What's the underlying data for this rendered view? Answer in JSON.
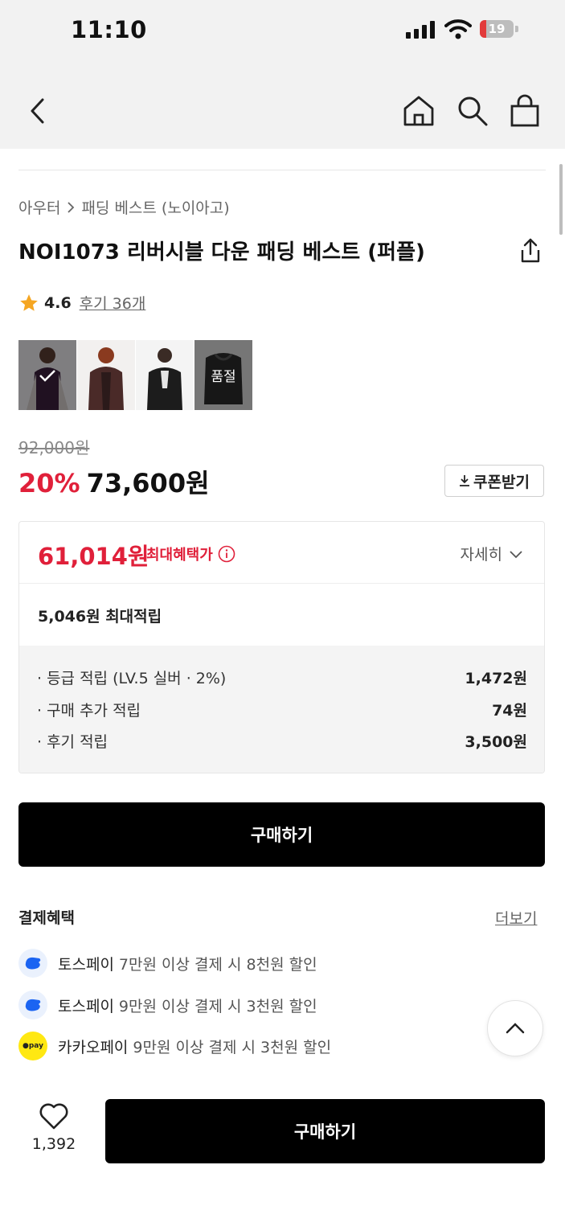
{
  "status_bar": {
    "time": "11:10",
    "battery": "19",
    "battery_level": 0.19,
    "battery_color": "#e23b3b"
  },
  "nav": {
    "back_icon": "chevron-left-icon",
    "home_icon": "home-icon",
    "search_icon": "search-icon",
    "bag_icon": "shopping-bag-icon"
  },
  "breadcrumb": {
    "category": "아우터",
    "separator_icon": "chevron-right-icon",
    "subcategory": "패딩 베스트 (노이아고)"
  },
  "product": {
    "title": "NOI1073 리버시블 다운 패딩 베스트 (퍼플)",
    "rating": "4.6",
    "reviews": "후기 36개",
    "thumbnails": [
      {
        "name": "thumb-purple",
        "selected": true,
        "overlay": ""
      },
      {
        "name": "thumb-brown",
        "selected": false,
        "overlay": ""
      },
      {
        "name": "thumb-black",
        "selected": false,
        "overlay": ""
      },
      {
        "name": "thumb-soldout",
        "selected": false,
        "overlay": "품절"
      }
    ],
    "original_price": "92,000원",
    "discount_rate": "20%",
    "sale_price": "73,600원",
    "coupon_label": "쿠폰받기"
  },
  "benefit": {
    "max_price": "61,014원",
    "max_label": "최대혜택가",
    "detail_label": "자세히",
    "earn_total": "5,046원 최대적립",
    "earn_rows": [
      {
        "label": "· 등급 적립 (LV.5 실버 · 2%)",
        "value": "1,472원"
      },
      {
        "label": "· 구매 추가 적립",
        "value": "74원"
      },
      {
        "label": "· 후기 적립",
        "value": "3,500원"
      }
    ]
  },
  "buy_label": "구매하기",
  "payment": {
    "title": "결제혜택",
    "more": "더보기",
    "items": [
      {
        "brand": "토스페이",
        "desc": "7만원 이상 결제 시 8천원 할인",
        "icon": "toss-icon",
        "color": "#1b64f2"
      },
      {
        "brand": "토스페이",
        "desc": "9만원 이상 결제 시 3천원 할인",
        "icon": "toss-icon",
        "color": "#1b64f2"
      },
      {
        "brand": "카카오페이",
        "desc": "9만원 이상 결제 시 3천원 할인",
        "icon": "kakaopay-icon",
        "icon_text": "●pay",
        "color": "#ffe812"
      }
    ]
  },
  "bottom": {
    "likes": "1,392",
    "buy_label": "구매하기"
  },
  "colors": {
    "accent_red": "#e0203a",
    "star": "#f5a623",
    "button_black": "#000000"
  }
}
